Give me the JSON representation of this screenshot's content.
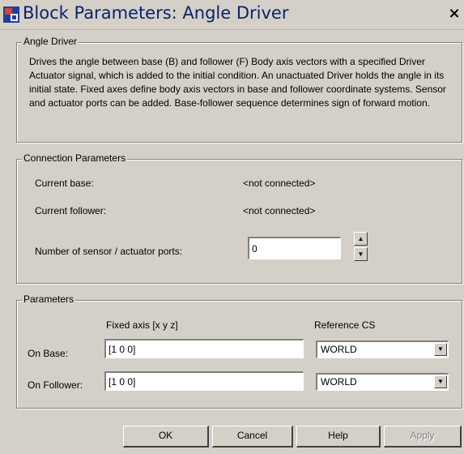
{
  "window": {
    "title": "Block Parameters: Angle Driver",
    "close_label": "×"
  },
  "description": {
    "legend": "Angle Driver",
    "text": "Drives the angle between base (B) and follower (F) Body axis vectors with a specified Driver Actuator signal, which is added to the initial condition. An unactuated Driver holds the angle in its initial state. Fixed axes define body axis vectors in base and follower coordinate systems. Sensor and actuator ports can be added. Base-follower sequence determines sign of forward motion."
  },
  "connection": {
    "legend": "Connection Parameters",
    "current_base_label": "Current base:",
    "current_base_value": "<not connected>",
    "current_follower_label": "Current follower:",
    "current_follower_value": "<not connected>",
    "ports_label": "Number of sensor / actuator ports:",
    "ports_value": "0"
  },
  "parameters": {
    "legend": "Parameters",
    "fixed_axis_header": "Fixed axis [x y z]",
    "reference_cs_header": "Reference CS",
    "on_base_label": "On Base:",
    "on_base_axis": "[1 0 0]",
    "on_base_cs": "WORLD",
    "on_follower_label": "On Follower:",
    "on_follower_axis": "[1 0 0]",
    "on_follower_cs": "WORLD"
  },
  "buttons": {
    "ok": "OK",
    "cancel": "Cancel",
    "help": "Help",
    "apply": "Apply"
  },
  "icons": {
    "app": "simulink-block-icon",
    "spin_up": "▲",
    "spin_down": "▼",
    "dropdown": "▼"
  }
}
